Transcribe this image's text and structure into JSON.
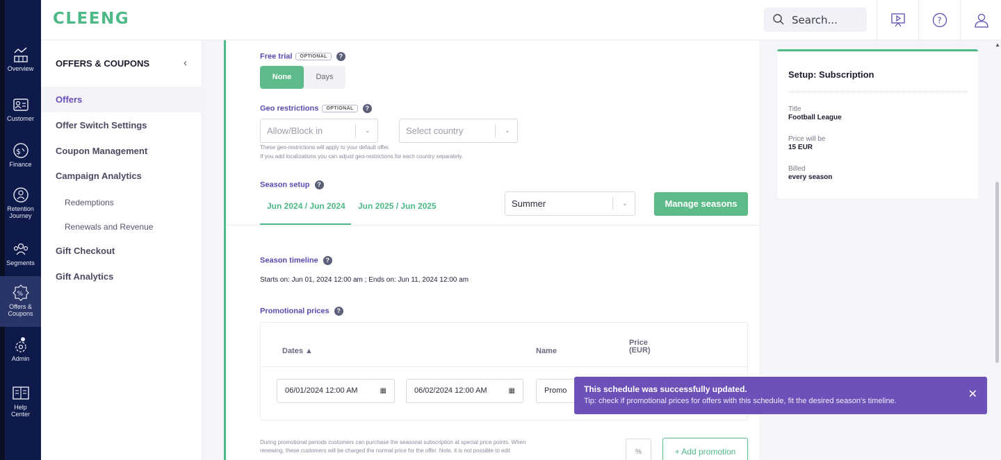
{
  "brand": {
    "logo": "CLEENG",
    "accent": "#4cb987",
    "nav_bg": "#0e1a4a",
    "toast_bg": "#6d51b8"
  },
  "header": {
    "search_placeholder": "Search..."
  },
  "rail": {
    "items": [
      {
        "label": "Overview",
        "icon": "chart-icon"
      },
      {
        "label": "Customer",
        "icon": "customer-card-icon"
      },
      {
        "label": "Finance",
        "icon": "dollar-gauge-icon"
      },
      {
        "label": "Retention Journey",
        "icon": "retention-icon"
      },
      {
        "label": "Segments",
        "icon": "segments-icon"
      },
      {
        "label": "Offers & Coupons",
        "icon": "percent-badge-icon"
      },
      {
        "label": "Admin",
        "icon": "admin-gear-icon"
      },
      {
        "label": "Help Center",
        "icon": "book-icon"
      }
    ]
  },
  "sidebar": {
    "title": "OFFERS & COUPONS",
    "items": [
      {
        "label": "Offers"
      },
      {
        "label": "Offer Switch Settings"
      },
      {
        "label": "Coupon Management"
      },
      {
        "label": "Campaign Analytics"
      },
      {
        "label": "Redemptions"
      },
      {
        "label": "Renewals and Revenue"
      },
      {
        "label": "Gift Checkout"
      },
      {
        "label": "Gift Analytics"
      }
    ]
  },
  "form": {
    "free_trial": {
      "label": "Free trial",
      "optional": "OPTIONAL",
      "options": [
        "None",
        "Days"
      ]
    },
    "geo": {
      "label": "Geo restrictions",
      "optional": "OPTIONAL",
      "allow_block": "Allow/Block in",
      "country": "Select country",
      "hint1": "These geo-restrictions will apply to your default offer.",
      "hint2": "If you add localizations you can adjust geo-restrictions for each country separately."
    },
    "season": {
      "label": "Season setup",
      "tabs": [
        "Jun 2024 / Jun 2024",
        "Jun 2025 / Jun 2025"
      ],
      "selected_season": "Summer",
      "manage": "Manage seasons"
    },
    "timeline": {
      "label": "Season timeline",
      "text": "Starts on: Jun 01, 2024 12:00 am ; Ends on: Jun 11, 2024 12:00 am"
    },
    "promo": {
      "label": "Promotional prices",
      "col_dates": "Dates ▲",
      "col_name": "Name",
      "col_price_1": "Price",
      "col_price_2": "(EUR)",
      "start": "06/01/2024 12:00 AM",
      "end": "06/02/2024 12:00 AM",
      "name": "Promo",
      "note1": "During promotional periods customers can purchase the seasonal subscription at special price points. When",
      "note2": "renewing, these customers will be charged the normal price for the offer. Note, it is not possible to edit",
      "percent": "%",
      "add": "+ Add promotion"
    }
  },
  "summary": {
    "title": "Setup: Subscription",
    "title_k": "Title",
    "title_v": "Football League",
    "price_k": "Price will be",
    "price_v": "15 EUR",
    "billed_k": "Billed",
    "billed_v": "every season"
  },
  "toast": {
    "title": "This schedule was successfully updated.",
    "tip": "Tip: check if promotional prices for offers with this schedule, fit the desired season's timeline."
  }
}
